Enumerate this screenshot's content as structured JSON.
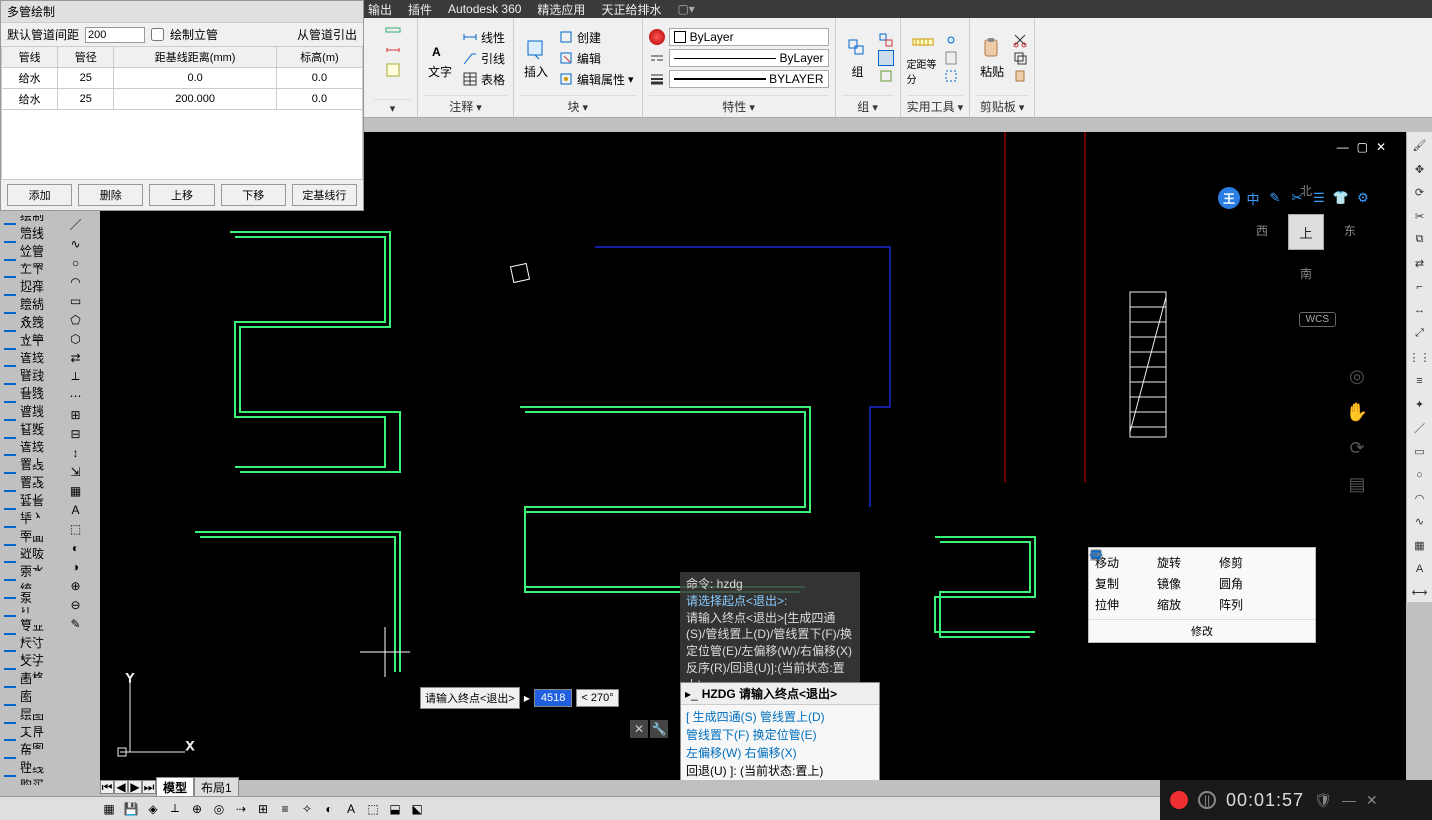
{
  "menu": {
    "items": [
      "输出",
      "插件",
      "Autodesk 360",
      "精选应用",
      "天正给排水"
    ]
  },
  "panel": {
    "title": "多管绘制",
    "spacing_label": "默认管道间距",
    "spacing_value": "200",
    "riser_check": "绘制立管",
    "from_pipe": "从管道引出",
    "headers": [
      "管线",
      "管径",
      "距基线距离(mm)",
      "标高(m)"
    ],
    "rows": [
      {
        "a": "给水",
        "b": "25",
        "c": "0.0",
        "d": "0.0"
      },
      {
        "a": "给水",
        "b": "25",
        "c": "200.000",
        "d": "0.0"
      }
    ],
    "btns": [
      "添加",
      "删除",
      "上移",
      "下移",
      "定基线行"
    ]
  },
  "ribbon": {
    "annotate": {
      "big": "文字",
      "items": [
        "线性",
        "引线",
        "表格"
      ],
      "label": "注释"
    },
    "block": {
      "big": "插入",
      "items": [
        "创建",
        "编辑",
        "编辑属性"
      ],
      "label": "块"
    },
    "props": {
      "layer": "ByLayer",
      "ltype": "ByLayer",
      "lweight": "BYLAYER",
      "label": "特性"
    },
    "group": {
      "big": "组",
      "label": "组"
    },
    "util": {
      "big": "定距等分",
      "label": "实用工具"
    },
    "clip": {
      "big": "粘贴",
      "label": "剪贴板"
    }
  },
  "side_left": [
    "绘制管线",
    "沿线绘管",
    "立管布置",
    "上下扣弯",
    "选择管线",
    "绘制多管",
    "双线水管",
    "立干连接",
    "管线联动",
    "管线升降",
    "管线遮挡",
    "管线打断",
    "管线连接",
    "管线置上",
    "管线置下",
    "管线延长",
    "套管插入",
    "平　面",
    "平面消防",
    "虹吸雨水",
    "系　统",
    "水 泵 间",
    "计　算",
    "专业标注",
    "尺寸标注",
    "文字表格",
    "图　库",
    "图　层",
    "绘图工具",
    "文件布图",
    "帮　助",
    "在线购买"
  ],
  "viewcube": {
    "n": "北",
    "s": "南",
    "e": "东",
    "w": "西",
    "top": "上",
    "wcs": "WCS"
  },
  "cmdlog": {
    "l1": "命令:  hzdg",
    "l2": "请选择起点<退出>:",
    "l3": "请输入终点<退出>[生成四通(S)/管线置上(D)/管线置下(F)/换定位管(E)/左偏移(W)/右偏移(X)反序(R)/回退(U)]:(当前状态:置上)"
  },
  "inline": {
    "prompt": "请输入终点<退出>",
    "value": "4518",
    "angle": "< 270°"
  },
  "cmdwin": {
    "head": "HZDG 请输入终点<退出>",
    "opts": [
      "[ 生成四通(S) 管线置上(D)",
      "管线置下(F) 换定位管(E)",
      "左偏移(W) 右偏移(X)",
      "回退(U) ]: (当前状态:置上)"
    ]
  },
  "editpop": {
    "rows": [
      [
        "移动",
        "旋转",
        "修剪"
      ],
      [
        "复制",
        "镜像",
        "圆角"
      ],
      [
        "拉伸",
        "缩放",
        "阵列"
      ]
    ],
    "foot": "修改"
  },
  "modeltabs": {
    "model": "模型",
    "layout": "布局1"
  },
  "rec": {
    "time": "00:01:57"
  },
  "pill": [
    "王",
    "中",
    "✎",
    "✂",
    "☰",
    "👕",
    "⚙"
  ]
}
